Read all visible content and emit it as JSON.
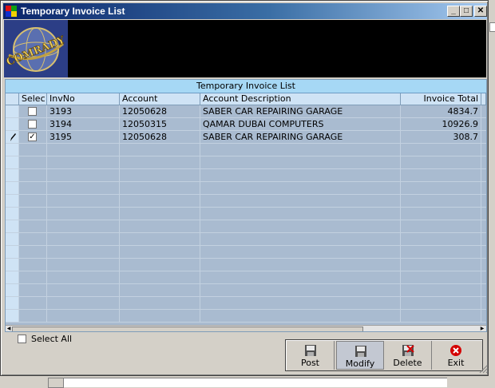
{
  "window": {
    "title": "Temporary Invoice List"
  },
  "titlebar_buttons": {
    "minimize": "_",
    "maximize": "□",
    "close": "✕"
  },
  "logo": {
    "text": "COMRADY",
    "icon": "globe-logo-icon"
  },
  "grid": {
    "caption": "Temporary Invoice List",
    "columns": [
      "Selec",
      "InvNo",
      "Account",
      "Account Description",
      "Invoice Total"
    ],
    "rows": [
      {
        "selected": false,
        "inv_no": "3193",
        "account": "12050628",
        "description": "SABER CAR REPAIRING GARAGE",
        "total": "4834.7",
        "editing": false
      },
      {
        "selected": false,
        "inv_no": "3194",
        "account": "12050315",
        "description": "QAMAR DUBAI COMPUTERS",
        "total": "10926.9",
        "editing": false
      },
      {
        "selected": true,
        "inv_no": "3195",
        "account": "12050628",
        "description": "SABER CAR REPAIRING GARAGE",
        "total": "308.7",
        "editing": true
      }
    ]
  },
  "select_all": {
    "label": "Select All",
    "checked": false
  },
  "actions": [
    {
      "id": "post",
      "label": "Post",
      "icon": "floppy-disk-icon"
    },
    {
      "id": "modify",
      "label": "Modify",
      "icon": "floppy-disk-icon"
    },
    {
      "id": "delete",
      "label": "Delete",
      "icon": "delete-disk-icon"
    },
    {
      "id": "exit",
      "label": "Exit",
      "icon": "exit-circle-icon"
    }
  ],
  "colors": {
    "titlebar": "#0a246a",
    "grid_bg": "#a9bbd0",
    "caption_bg": "#a6d8f5",
    "exit_red": "#d40000"
  }
}
